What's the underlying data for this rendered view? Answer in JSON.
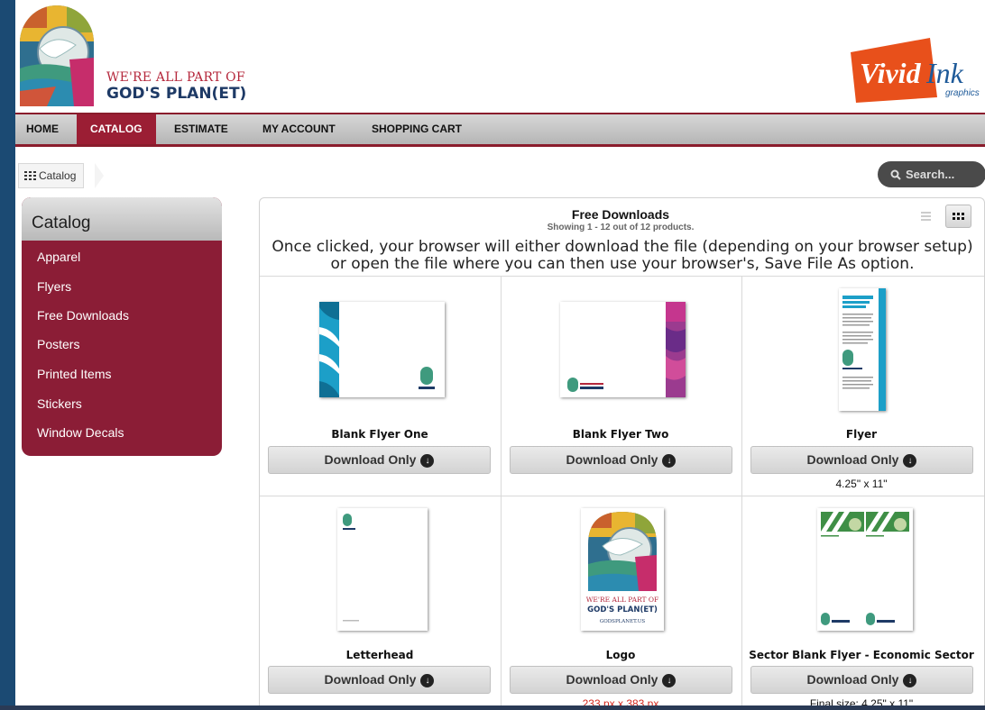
{
  "brand": {
    "tagline_line1": "WE'RE ALL PART OF",
    "tagline_line2": "GOD'S PLAN(ET)",
    "partner_name": "VividInk",
    "partner_sub": "graphics"
  },
  "nav": {
    "items": [
      "HOME",
      "CATALOG",
      "ESTIMATE",
      "MY ACCOUNT",
      "SHOPPING CART"
    ],
    "active": "CATALOG"
  },
  "breadcrumb": {
    "label": "Catalog"
  },
  "search": {
    "placeholder": "Search..."
  },
  "sidebar": {
    "title": "Catalog",
    "items": [
      "Apparel",
      "Flyers",
      "Free Downloads",
      "Posters",
      "Printed Items",
      "Stickers",
      "Window Decals"
    ]
  },
  "content": {
    "title": "Free Downloads",
    "subtitle": "Showing 1 - 12 out of 12 products.",
    "note": "Once clicked, your browser will either download the file (depending on your browser setup) or open the file where you can then use your browser's, Save File As option."
  },
  "products": [
    {
      "name": "Blank Flyer One",
      "button": "Download Only",
      "note": ""
    },
    {
      "name": "Blank Flyer Two",
      "button": "Download Only",
      "note": ""
    },
    {
      "name": "Flyer",
      "button": "Download Only",
      "note": "4.25\" x 11\""
    },
    {
      "name": "Letterhead",
      "button": "Download Only",
      "note": ""
    },
    {
      "name": "Logo",
      "button": "Download Only",
      "note": "233 px x 383 px"
    },
    {
      "name": "Sector Blank Flyer - Economic Sector",
      "button": "Download Only",
      "note": "Final size: 4.25\" x 11\""
    }
  ],
  "thumb_text": {
    "mini_logo": "GOD'S PLANET",
    "logo_line1": "WE'RE ALL PART OF",
    "logo_line2": "GOD'S PLAN(ET)",
    "logo_url": "GODSPLANET.US",
    "flyer_heading": "In the beginning, God created our common home.",
    "sector_label": "ECONOMIC SECTOR"
  },
  "colors": {
    "brand_red": "#9b1e34",
    "brand_navy": "#1e3a66",
    "vivid_orange": "#e8501b",
    "note_red": "#d2261c"
  }
}
